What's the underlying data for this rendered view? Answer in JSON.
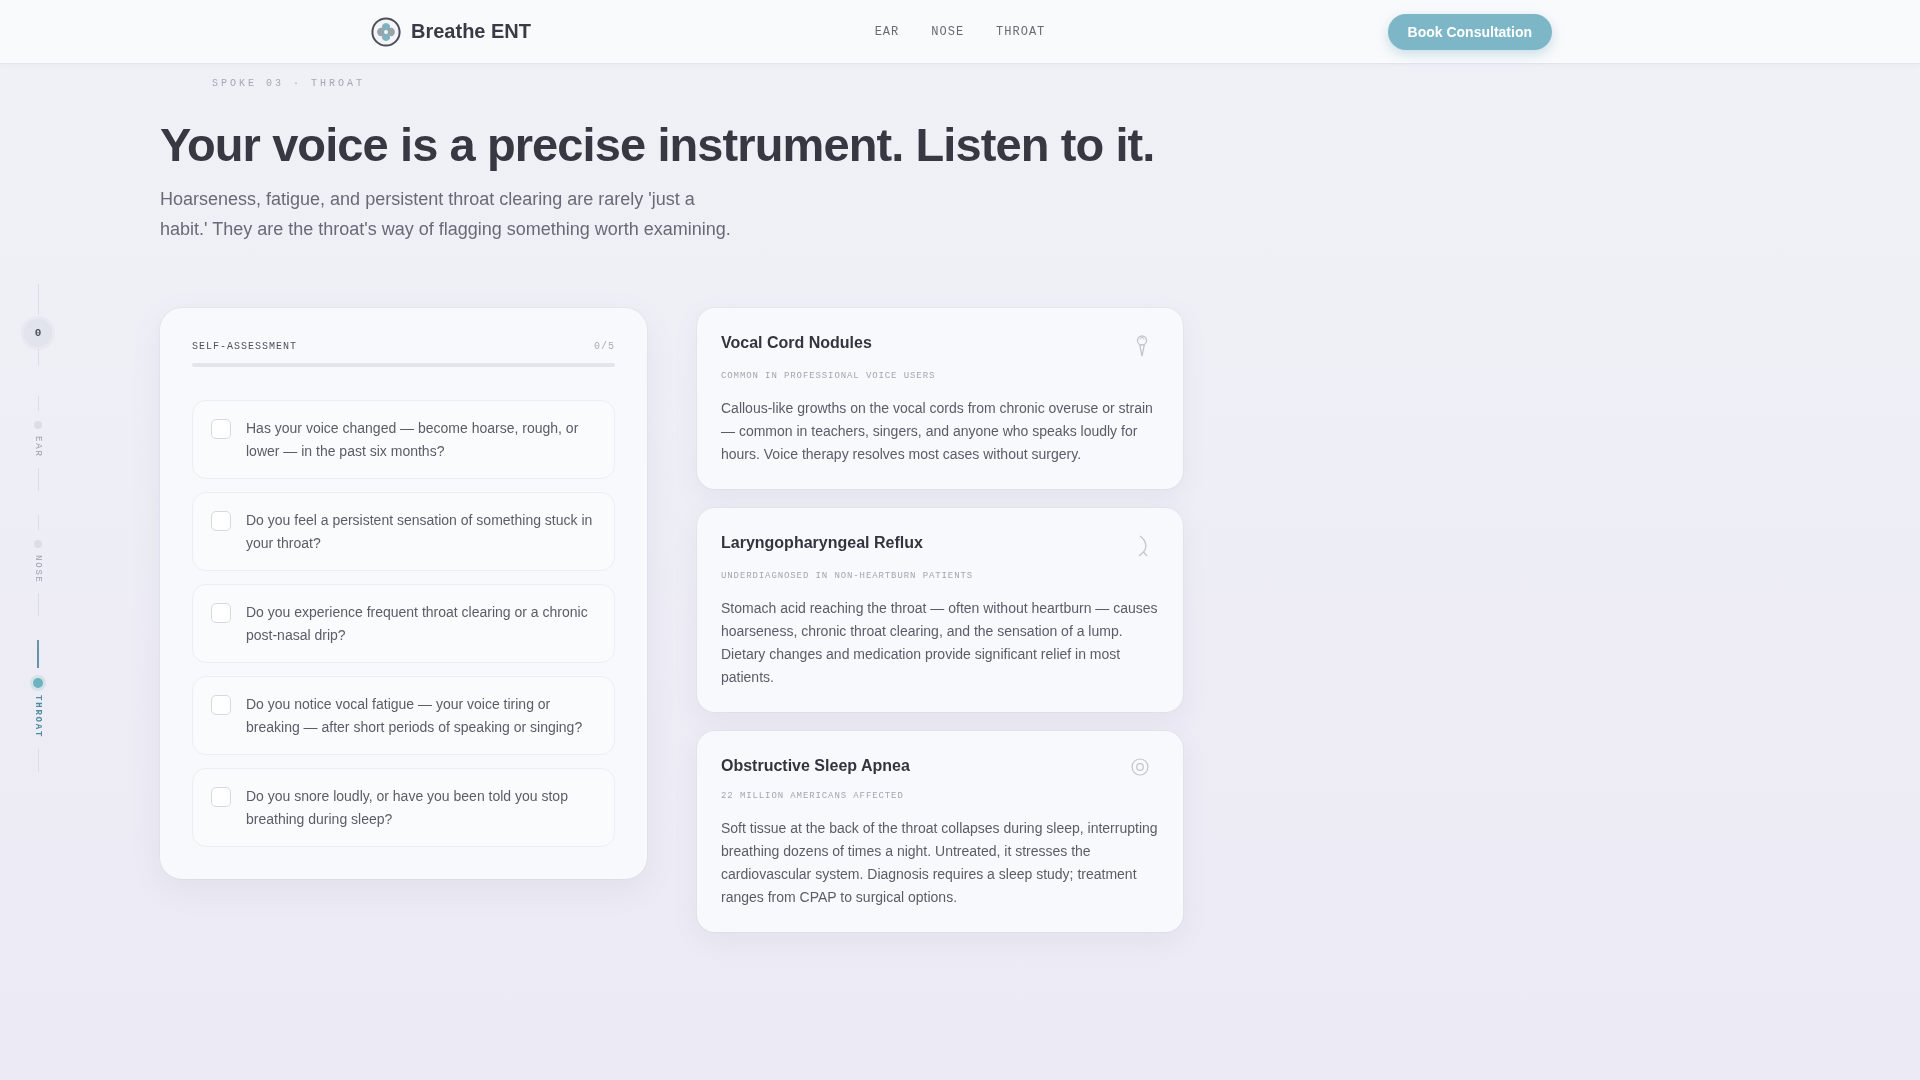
{
  "header": {
    "brand": "Breathe ENT",
    "nav": [
      "EAR",
      "NOSE",
      "THROAT"
    ],
    "cta": "Book Consultation"
  },
  "side_rail": {
    "counter": "0",
    "items": [
      {
        "label": "EAR",
        "selected": false
      },
      {
        "label": "NOSE",
        "selected": false
      },
      {
        "label": "THROAT",
        "selected": true
      }
    ]
  },
  "hero": {
    "breadcrumb": "SPOKE 03 · THROAT",
    "headline": "Your voice is a precise instrument. Listen to it.",
    "intro": "Hoarseness, fatigue, and persistent throat clearing are rarely 'just a habit.' They are the throat's way of flagging something worth examining."
  },
  "self_assessment": {
    "title": "SELF-ASSESSMENT",
    "count": "0/5",
    "level": 0,
    "questions": [
      {
        "text": "Has your voice changed — become hoarse, rough, or lower — in the past six months?",
        "checked": false
      },
      {
        "text": "Do you feel a persistent sensation of something stuck in your throat?",
        "checked": false
      },
      {
        "text": "Do you experience frequent throat clearing or a chronic post-nasal drip?",
        "checked": false
      },
      {
        "text": "Do you notice vocal fatigue — your voice tiring or breaking — after short periods of speaking or singing?",
        "checked": false
      },
      {
        "text": "Do you snore loudly, or have you been told you stop breathing during sleep?",
        "checked": false
      }
    ]
  },
  "conditions": [
    {
      "title": "Vocal Cord Nodules",
      "subtitle": "COMMON IN PROFESSIONAL VOICE USERS",
      "description": "Callous-like growths on the vocal cords from chronic overuse or strain — common in teachers, singers, and anyone who speaks loudly for hours. Voice therapy resolves most cases without surgery."
    },
    {
      "title": "Laryngopharyngeal Reflux",
      "subtitle": "UNDERDIAGNOSED IN NON-HEARTBURN PATIENTS",
      "description": "Stomach acid reaching the throat — often without heartburn — causes hoarseness, chronic throat clearing, and the sensation of a lump. Dietary changes and medication provide significant relief in most patients."
    },
    {
      "title": "Obstructive Sleep Apnea",
      "subtitle": "22 MILLION AMERICANS AFFECTED",
      "description": "Soft tissue at the back of the throat collapses during sleep, interrupting breathing dozens of times a night. Untreated, it stresses the cardiovascular system. Diagnosis requires a sleep study; treatment ranges from CPAP to surgical options."
    }
  ]
}
